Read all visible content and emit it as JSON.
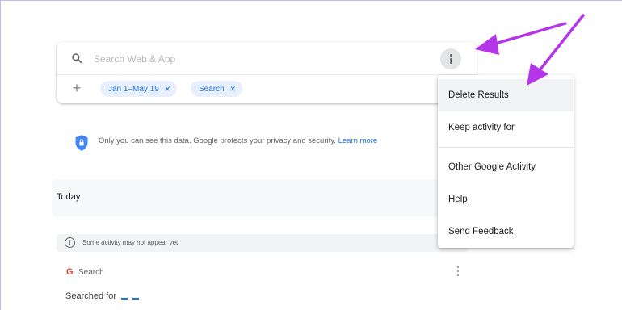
{
  "search": {
    "placeholder": "Search Web & App",
    "more_label": "More options"
  },
  "filters": {
    "chips": [
      {
        "label": "Jan 1–May 19",
        "close": "×"
      },
      {
        "label": "Search",
        "close": "×"
      }
    ],
    "add_symbol": "+"
  },
  "privacy": {
    "text": "Only you can see this data. Google protects your privacy and security.",
    "link": "Learn more"
  },
  "section": {
    "title": "Today",
    "notice": "Some activity may not appear yet",
    "info_symbol": "i"
  },
  "activity": {
    "product_icon": "G",
    "product": "Search",
    "action": "Searched for"
  },
  "menu": {
    "items": [
      {
        "label": "Delete Results"
      },
      {
        "label": "Keep activity for"
      },
      {
        "label": "Other Google Activity"
      },
      {
        "label": "Help"
      },
      {
        "label": "Send Feedback"
      }
    ]
  },
  "colors": {
    "accent": "#1a73e8",
    "arrow": "#b535e8",
    "chip_bg": "#e8f0fe"
  },
  "icons": {
    "search": "search-icon",
    "more": "more-vertical-icon",
    "add": "plus-icon",
    "chip_close": "close-icon",
    "shield": "shield-icon",
    "info": "info-icon",
    "google": "google-icon"
  }
}
